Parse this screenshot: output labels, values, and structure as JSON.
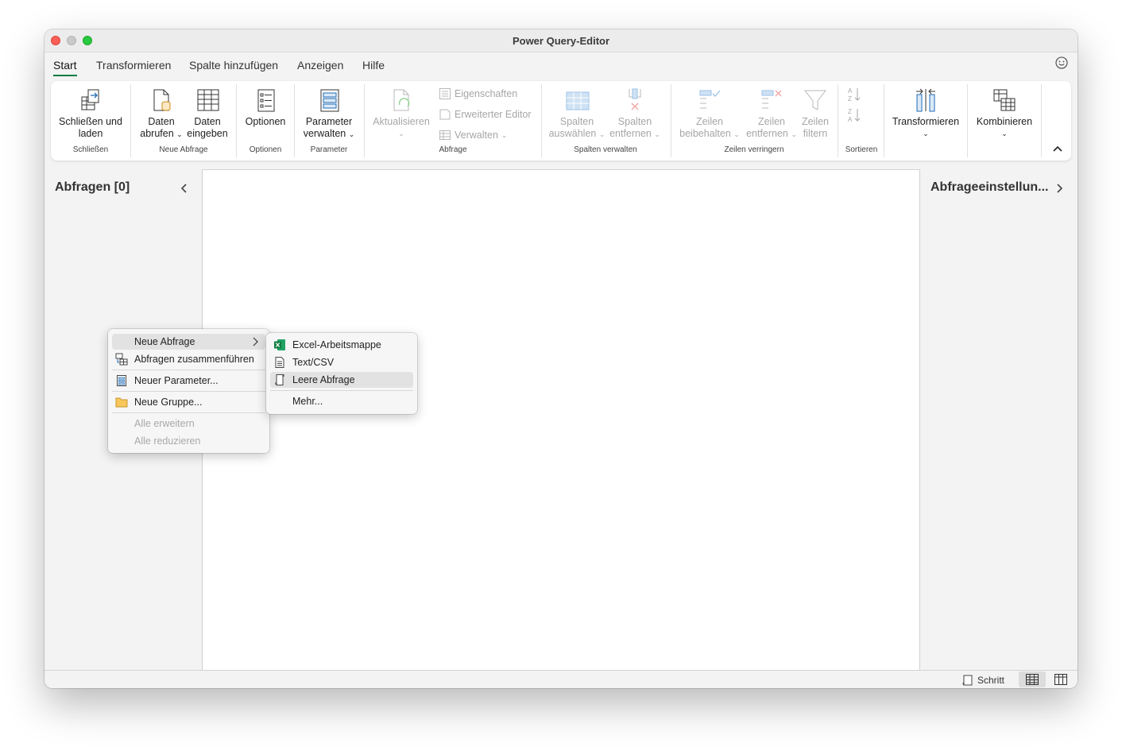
{
  "window": {
    "title": "Power Query-Editor"
  },
  "menu": {
    "tabs": [
      "Start",
      "Transformieren",
      "Spalte hinzufügen",
      "Anzeigen",
      "Hilfe"
    ],
    "active": "Start"
  },
  "ribbon": {
    "close_load": "Schließen und laden",
    "close_load_l1": "Schließen und",
    "close_load_l2": "laden",
    "group_close": "Schließen",
    "get_data_l1": "Daten",
    "get_data_l2": "abrufen",
    "enter_data_l1": "Daten",
    "enter_data_l2": "eingeben",
    "group_new_query": "Neue Abfrage",
    "options": "Optionen",
    "group_options": "Optionen",
    "params_l1": "Parameter",
    "params_l2": "verwalten",
    "group_params": "Parameter",
    "refresh": "Aktualisieren",
    "properties": "Eigenschaften",
    "advanced_editor": "Erweiterter Editor",
    "manage": "Verwalten",
    "group_query": "Abfrage",
    "choose_cols_l1": "Spalten",
    "choose_cols_l2": "auswählen",
    "remove_cols_l1": "Spalten",
    "remove_cols_l2": "entfernen",
    "group_manage_cols": "Spalten verwalten",
    "keep_rows_l1": "Zeilen",
    "keep_rows_l2": "beibehalten",
    "remove_rows_l1": "Zeilen",
    "remove_rows_l2": "entfernen",
    "filter_rows_l1": "Zeilen",
    "filter_rows_l2": "filtern",
    "group_reduce_rows": "Zeilen verringern",
    "group_sort": "Sortieren",
    "transform": "Transformieren",
    "combine": "Kombinieren"
  },
  "left_pane": {
    "title": "Abfragen [0]"
  },
  "right_pane": {
    "title": "Abfrageeinstellun..."
  },
  "status": {
    "step": "Schritt"
  },
  "context_menu": {
    "new_query": "Neue Abfrage",
    "merge_queries": "Abfragen zusammenführen",
    "new_param": "Neuer Parameter...",
    "new_group": "Neue Gruppe...",
    "expand_all": "Alle erweitern",
    "collapse_all": "Alle reduzieren"
  },
  "submenu": {
    "excel": "Excel-Arbeitsmappe",
    "text_csv": "Text/CSV",
    "blank_query": "Leere Abfrage",
    "more": "Mehr..."
  },
  "colors": {
    "accent": "#107c41",
    "icon_blue": "#1f6bb5",
    "disabled": "#a6a6a6"
  }
}
